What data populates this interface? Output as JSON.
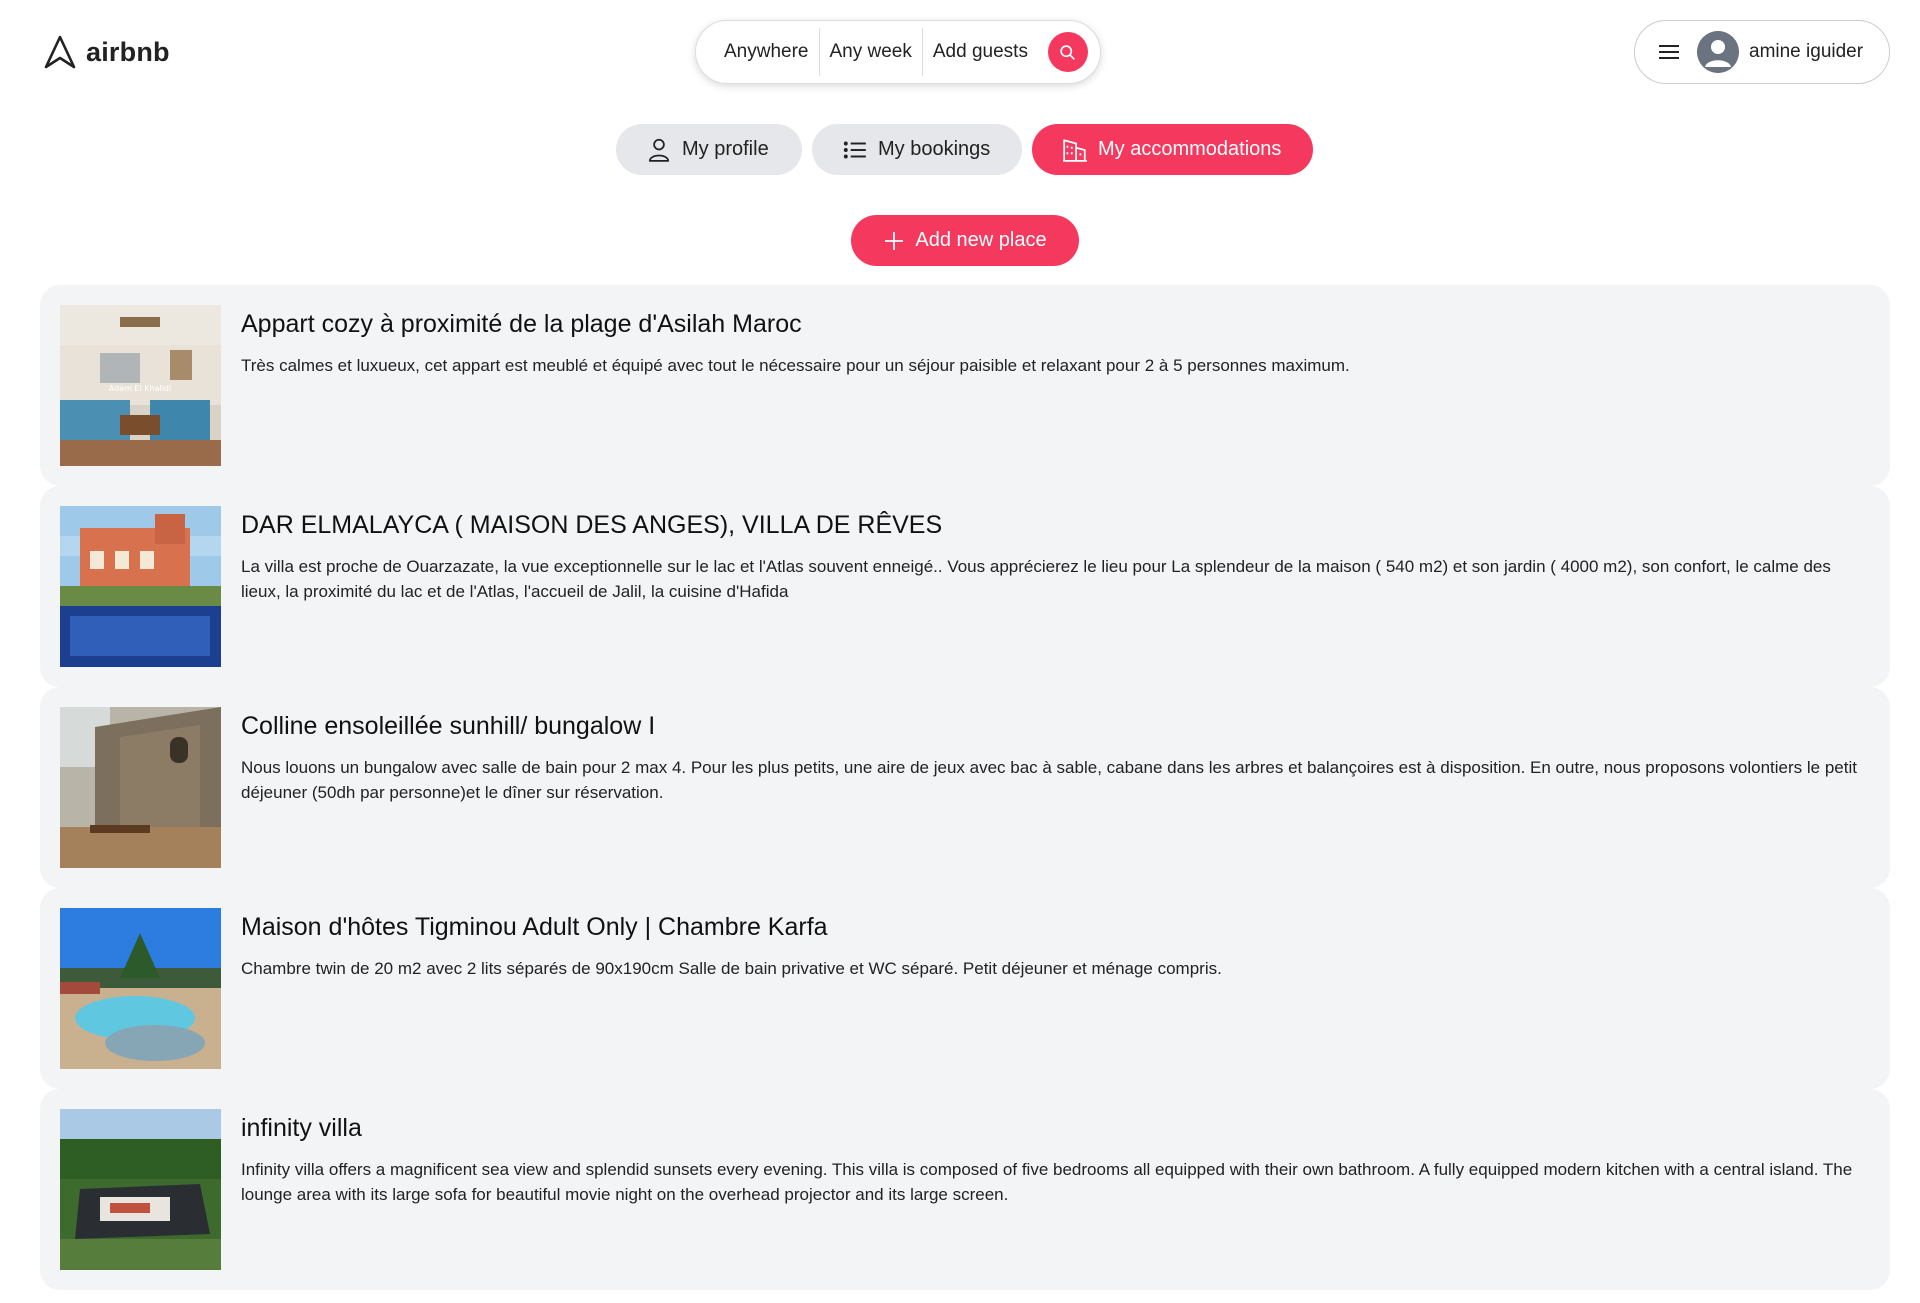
{
  "brand": {
    "name": "airbnb",
    "color": "#f5385d"
  },
  "search": {
    "where": "Anywhere",
    "when": "Any week",
    "who": "Add guests"
  },
  "user": {
    "name": "amine iguider"
  },
  "tabs": [
    {
      "label": "My profile",
      "icon": "user-icon",
      "active": false
    },
    {
      "label": "My bookings",
      "icon": "list-icon",
      "active": false
    },
    {
      "label": "My accommodations",
      "icon": "building-icon",
      "active": true
    }
  ],
  "add_place_label": "Add new place",
  "listings": [
    {
      "title": "Appart cozy à proximité de la plage d'Asilah Maroc",
      "description": "Très calmes et luxueux, cet appart est meublé et équipé avec tout le nécessaire pour un séjour paisible et relaxant pour 2 à 5 personnes maximum.",
      "photo_caption": "Adam El Khalidi"
    },
    {
      "title": "DAR ELMALAYCA ( MAISON DES ANGES), VILLA DE RÊVES",
      "description": "La villa est proche de Ouarzazate, la vue exceptionnelle sur le lac et l'Atlas souvent enneigé.. Vous apprécierez le lieu pour La splendeur de la maison ( 540 m2) et son jardin ( 4000 m2), son confort, le calme des lieux, la proximité du lac et de l'Atlas, l'accueil de Jalil, la cuisine d'Hafida"
    },
    {
      "title": "Colline ensoleillée sunhill/ bungalow I",
      "description": "Nous louons un bungalow avec salle de bain pour 2 max 4. Pour les plus petits, une aire de jeux avec bac à sable, cabane dans les arbres et balançoires est à disposition. En outre, nous proposons volontiers le petit déjeuner (50dh par personne)et le dîner sur réservation."
    },
    {
      "title": "Maison d'hôtes Tigminou Adult Only | Chambre Karfa",
      "description": "Chambre twin de 20 m2 avec 2 lits séparés de 90x190cm Salle de bain privative et WC séparé. Petit déjeuner et ménage compris."
    },
    {
      "title": "infinity villa",
      "description": "Infinity villa offers a magnificent sea view and splendid sunsets every evening. This villa is composed of five bedrooms all equipped with their own bathroom. A fully equipped modern kitchen with a central island. The lounge area with its large sofa for beautiful movie night on the overhead projector and its large screen."
    }
  ]
}
